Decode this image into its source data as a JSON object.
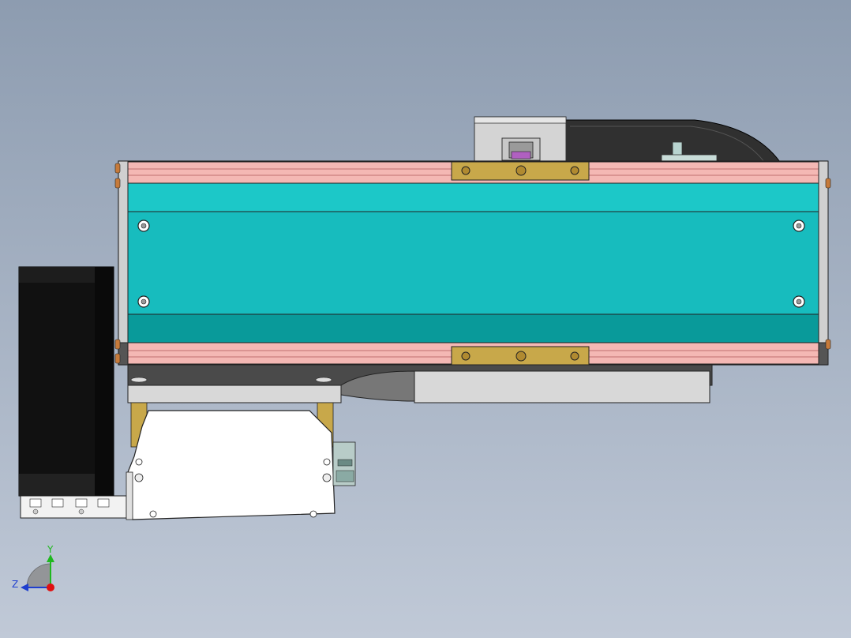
{
  "view": {
    "background_top": "#8d9cb0",
    "background_bottom": "#c0c9d7"
  },
  "colors": {
    "module_body": "#17bcbe",
    "module_body_dark": "#099a9a",
    "rail_pink": "#f4b8b4",
    "carriage_gold": "#c8a84a",
    "drag_chain": "#2a2a2a",
    "motor_black": "#111111",
    "frame_grey": "#d8d8d8",
    "cable_box_white": "#ffffff"
  },
  "triad": {
    "y_label": "Y",
    "z_label": "Z",
    "y_color": "#1fb81f",
    "z_color": "#1f3fcf",
    "x_color": "#e01010"
  }
}
